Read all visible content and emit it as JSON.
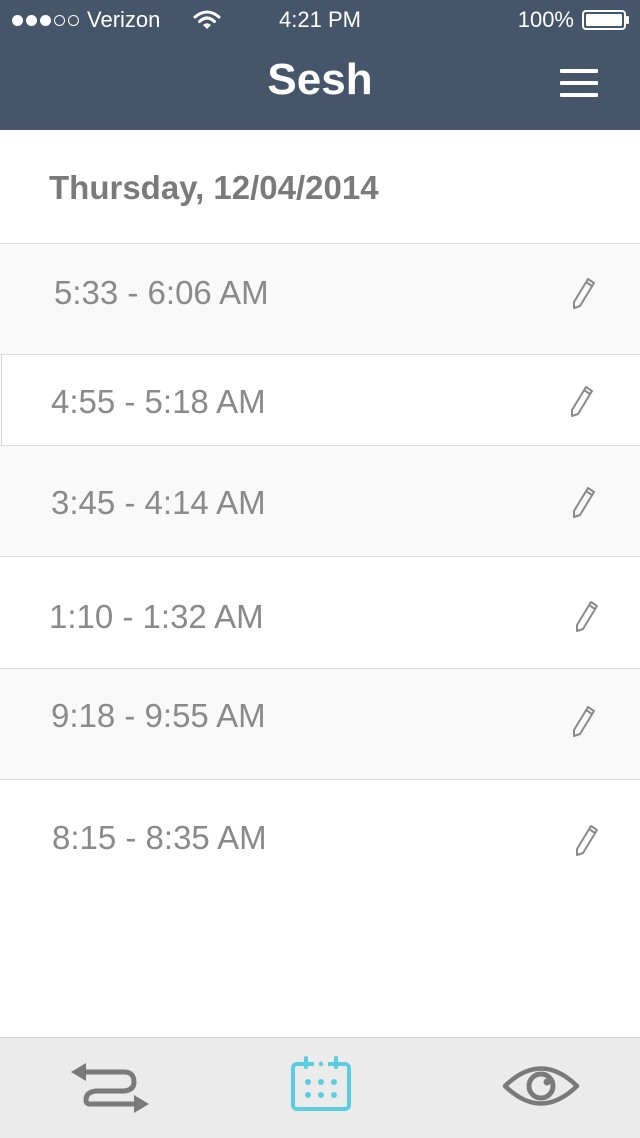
{
  "status_bar": {
    "carrier": "Verizon",
    "time": "4:21 PM",
    "battery": "100%",
    "signal_bars_filled": 3,
    "signal_bars_total": 5
  },
  "nav": {
    "title": "Sesh",
    "menu_icon": "hamburger-menu-icon"
  },
  "date_header": {
    "label": "Thursday, 12/04/2014"
  },
  "sessions": [
    {
      "time_range": "5:33 - 6:06 AM",
      "action_icon": "pencil-icon"
    },
    {
      "time_range": "4:55 - 5:18 AM",
      "action_icon": "pencil-icon"
    },
    {
      "time_range": "3:45 - 4:14 AM",
      "action_icon": "pencil-icon"
    },
    {
      "time_range": "1:10 - 1:32 AM",
      "action_icon": "pencil-icon"
    },
    {
      "time_range": "9:18 - 9:55 AM",
      "action_icon": "pencil-icon"
    },
    {
      "time_range": "8:15 - 8:35 AM",
      "action_icon": "pencil-icon"
    }
  ],
  "tab_bar": {
    "tabs": [
      {
        "icon": "swap-arrows-icon",
        "active": false
      },
      {
        "icon": "calendar-icon",
        "active": true
      },
      {
        "icon": "eye-icon",
        "active": false
      }
    ]
  },
  "colors": {
    "header_bg": "#46566a",
    "active_tab": "#5bcde0",
    "inactive_tab": "#7a7a7a",
    "text_gray": "#8a8a8a",
    "row_alt_bg": "#f9f9f9",
    "tab_bar_bg": "#ebebeb"
  }
}
